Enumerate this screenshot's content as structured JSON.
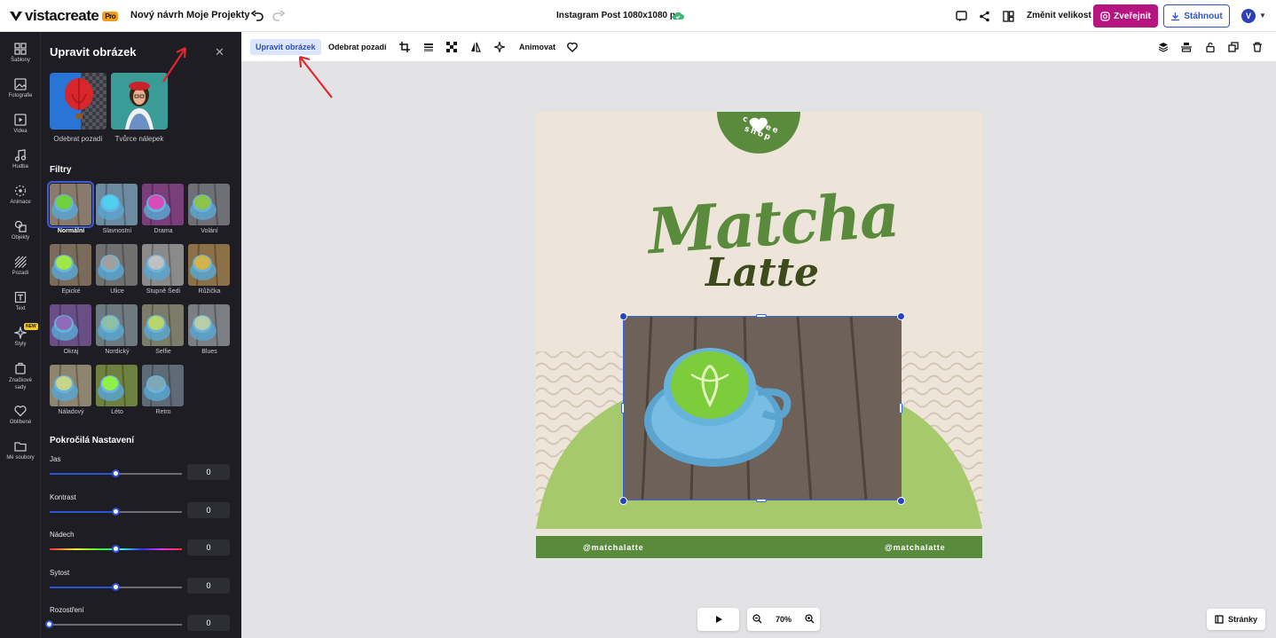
{
  "header": {
    "logo": "vistacreate",
    "pro_badge": "Pro",
    "nav_new": "Nový návrh",
    "nav_projects": "Moje Projekty",
    "doc_title": "Instagram Post 1080x1080 px",
    "resize": "Změnit velikost",
    "publish": "Zveřejnit",
    "download": "Stáhnout",
    "avatar": "V"
  },
  "rail": {
    "items": [
      {
        "label": "Šablony",
        "icon": "templates-icon"
      },
      {
        "label": "Fotografie",
        "icon": "photo-icon"
      },
      {
        "label": "Videa",
        "icon": "video-icon"
      },
      {
        "label": "Hudba",
        "icon": "music-icon"
      },
      {
        "label": "Animace",
        "icon": "animation-icon"
      },
      {
        "label": "Objekty",
        "icon": "objects-icon"
      },
      {
        "label": "Pozadí",
        "icon": "background-icon"
      },
      {
        "label": "Text",
        "icon": "text-icon"
      },
      {
        "label": "Styly",
        "icon": "styles-icon"
      },
      {
        "label": "Značkové sady",
        "icon": "brand-kit-icon"
      },
      {
        "label": "Oblíbené",
        "icon": "heart-icon"
      },
      {
        "label": "Mé soubory",
        "icon": "folder-icon"
      }
    ],
    "new_badge": "NEW"
  },
  "panel": {
    "title": "Upravit obrázek",
    "tools": [
      "Odebrat pozadí",
      "Tvůrce nálepek"
    ],
    "filters_title": "Filtry",
    "filters": [
      "Normální",
      "Slavnostní",
      "Drama",
      "Volání",
      "Epické",
      "Ulice",
      "Stupně Šedi",
      "Růžička",
      "Okraj",
      "Nordický",
      "Selfie",
      "Blues",
      "Náladový",
      "Léto",
      "Retro"
    ],
    "selected_filter": "Normální",
    "advanced_title": "Pokročilá Nastavení",
    "sliders": [
      {
        "label": "Jas",
        "value": "0",
        "level": 0.5
      },
      {
        "label": "Kontrast",
        "value": "0",
        "level": 0.5
      },
      {
        "label": "Nádech",
        "value": "0",
        "level": 0.5
      },
      {
        "label": "Sytost",
        "value": "0",
        "level": 0.5
      },
      {
        "label": "Rozostření",
        "value": "0",
        "level": 0.0
      }
    ]
  },
  "toolbar": {
    "edit_image": "Upravit obrázek",
    "remove_bg": "Odebrat pozadí",
    "animate": "Animovat"
  },
  "design": {
    "badge_text": "coffee shop",
    "title_1": "Matcha",
    "title_2": "Latte",
    "handle_left": "@matchalatte",
    "handle_right": "@matchalatte",
    "colors": {
      "green_dark": "#5a8a3c",
      "green_light": "#a5c96b",
      "bg": "#ede5d9",
      "brown": "#3d4a1b"
    }
  },
  "bottom": {
    "zoom": "70%",
    "pages": "Stránky"
  }
}
